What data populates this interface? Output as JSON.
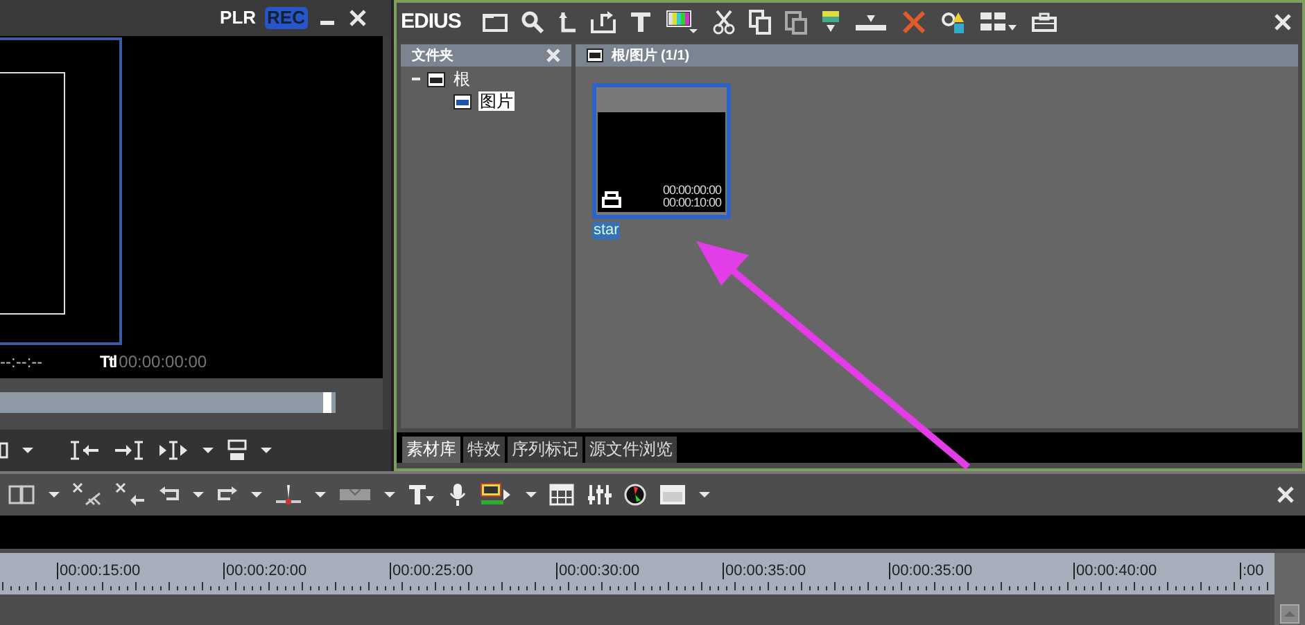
{
  "player": {
    "modes": [
      {
        "label": "PLR",
        "selected": false
      },
      {
        "label": "REC",
        "selected": true
      }
    ],
    "timecode": "--:--:--",
    "total_label": "Ttl",
    "total_timecode": "00:00:00:00",
    "scrub": {
      "level": 0.985
    }
  },
  "bin": {
    "title": "EDIUS",
    "folder_pane": {
      "title": "文件夹",
      "tree": [
        {
          "label": "根",
          "expanded": true,
          "selected": false,
          "children": [
            {
              "label": "图片",
              "selected": true
            }
          ]
        }
      ]
    },
    "path": "根/图片 (1/1)",
    "clips": [
      {
        "name": "star",
        "selected": true,
        "in": "00:00:00:00",
        "out": "00:00:10:00"
      }
    ],
    "tabs": [
      {
        "label": "素材库",
        "selected": true
      },
      {
        "label": "特效",
        "selected": false
      },
      {
        "label": "序列标记",
        "selected": false
      },
      {
        "label": "源文件浏览",
        "selected": false
      }
    ]
  },
  "timeline": {
    "ruler": [
      "00:00:15:00",
      "00:00:20:00",
      "00:00:25:00",
      "00:00:30:00",
      "00:00:35:00",
      "00:00:35:00",
      "00:00:40:00",
      ":00"
    ]
  }
}
